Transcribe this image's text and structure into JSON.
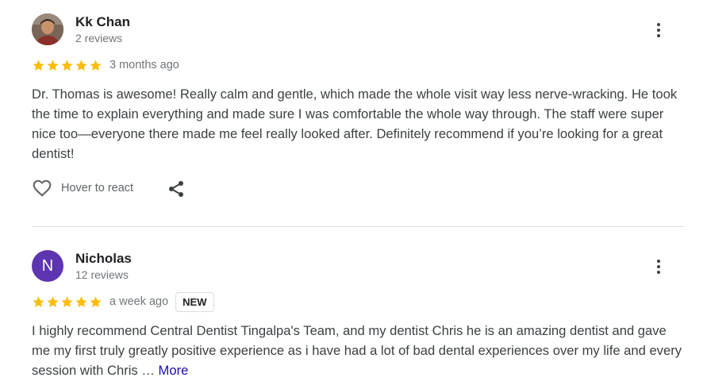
{
  "reviews": [
    {
      "author": "Kk Chan",
      "review_count": "2 reviews",
      "rating": 5,
      "date": "3 months ago",
      "text": "Dr. Thomas is awesome! Really calm and gentle, which made the whole visit way less nerve-wracking. He took the time to explain everything and made sure I was comfortable the whole way through. The staff were super nice too—everyone there made me feel really looked after. Definitely recommend if you’re looking for a great dentist!",
      "react_label": "Hover to react"
    },
    {
      "author": "Nicholas",
      "avatar_letter": "N",
      "avatar_color": "#5e35b1",
      "review_count": "12 reviews",
      "rating": 5,
      "date": "a week ago",
      "badge": "NEW",
      "text": "I highly recommend Central Dentist Tingalpa's Team, and my dentist Chris he is an amazing dentist and gave me my first truly greatly positive experience as i have had a lot of bad dental experiences over my life and every session with Chris …",
      "more_label": "More"
    }
  ],
  "icons": {
    "star": "star-icon",
    "more": "more-vert-icon",
    "heart": "heart-outline-icon",
    "share": "share-icon"
  },
  "colors": {
    "star": "#fbbc04",
    "link": "#1a0dab",
    "divider": "#dadce0"
  }
}
